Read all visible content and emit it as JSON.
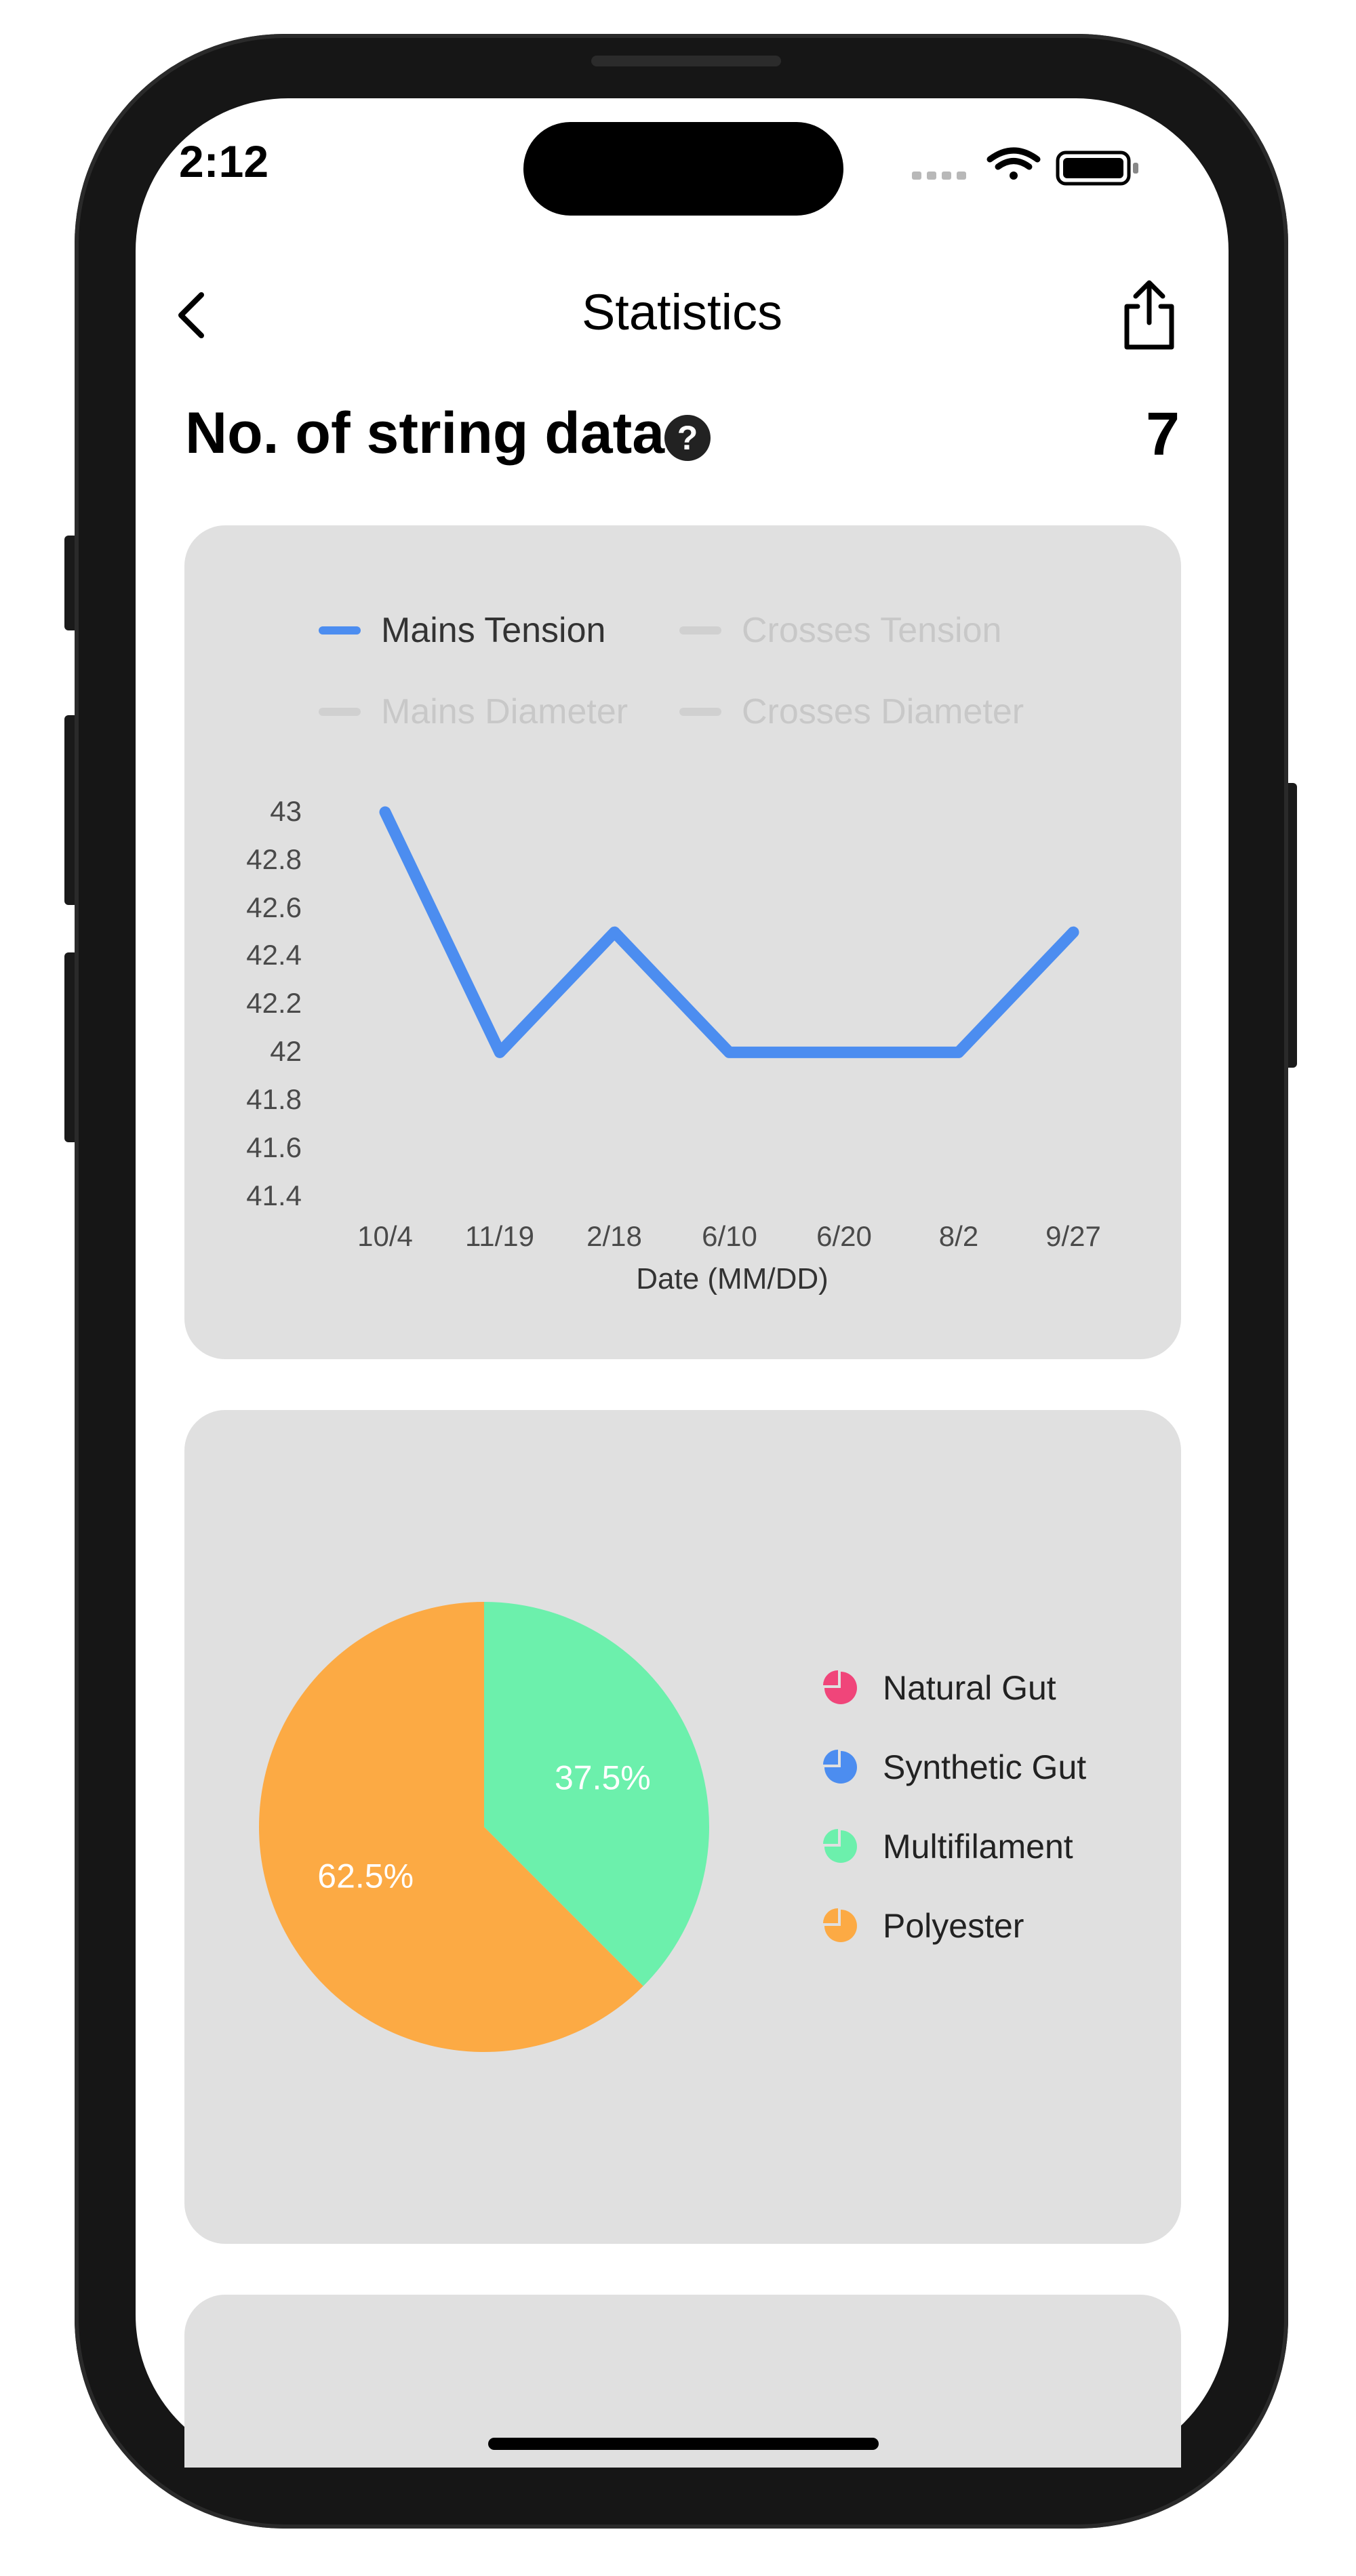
{
  "status_bar": {
    "time": "2:12",
    "icons": [
      "cellular-signal-icon",
      "wifi-icon",
      "battery-icon"
    ]
  },
  "nav": {
    "title": "Statistics",
    "back_icon": "chevron-left-icon",
    "share_icon": "share-icon"
  },
  "summary": {
    "title": "No. of string data",
    "help_icon": "question-mark-icon",
    "count": "7"
  },
  "line_chart": {
    "legend": [
      {
        "label": "Mains Tension",
        "active": true,
        "color": "#4c8df0"
      },
      {
        "label": "Crosses Tension",
        "active": false,
        "color": "#d0d0d0"
      },
      {
        "label": "Mains Diameter",
        "active": false,
        "color": "#d0d0d0"
      },
      {
        "label": "Crosses Diameter",
        "active": false,
        "color": "#d0d0d0"
      }
    ],
    "y_ticks": [
      "43",
      "42.8",
      "42.6",
      "42.4",
      "42.2",
      "42",
      "41.8",
      "41.6",
      "41.4"
    ],
    "x_ticks": [
      "10/4",
      "11/19",
      "2/18",
      "6/10",
      "6/20",
      "8/2",
      "9/27"
    ],
    "xlabel": "Date (MM/DD)"
  },
  "pie_chart": {
    "labels": [
      "62.5%",
      "37.5%"
    ],
    "legend": [
      {
        "label": "Natural Gut",
        "color": "#f0457a"
      },
      {
        "label": "Synthetic Gut",
        "color": "#4c8df0"
      },
      {
        "label": "Multifilament",
        "color": "#6cf0ac"
      },
      {
        "label": "Polyester",
        "color": "#fcaa44"
      }
    ]
  },
  "chart_data": [
    {
      "type": "line",
      "x": [
        "10/4",
        "11/19",
        "2/18",
        "6/10",
        "6/20",
        "8/2",
        "9/27"
      ],
      "series": [
        {
          "name": "Mains Tension",
          "values": [
            43,
            42,
            42.5,
            42,
            42,
            42,
            42.5
          ]
        }
      ],
      "xlabel": "Date (MM/DD)",
      "ylabel": "",
      "ylim": [
        41.4,
        43
      ],
      "legend_position": "top",
      "grid": false,
      "color": "#4c8df0"
    },
    {
      "type": "pie",
      "categories": [
        "Natural Gut",
        "Synthetic Gut",
        "Multifilament",
        "Polyester"
      ],
      "values": [
        0,
        0,
        37.5,
        62.5
      ],
      "colors": [
        "#f0457a",
        "#4c8df0",
        "#6cf0ac",
        "#fcaa44"
      ],
      "legend_position": "right"
    }
  ]
}
